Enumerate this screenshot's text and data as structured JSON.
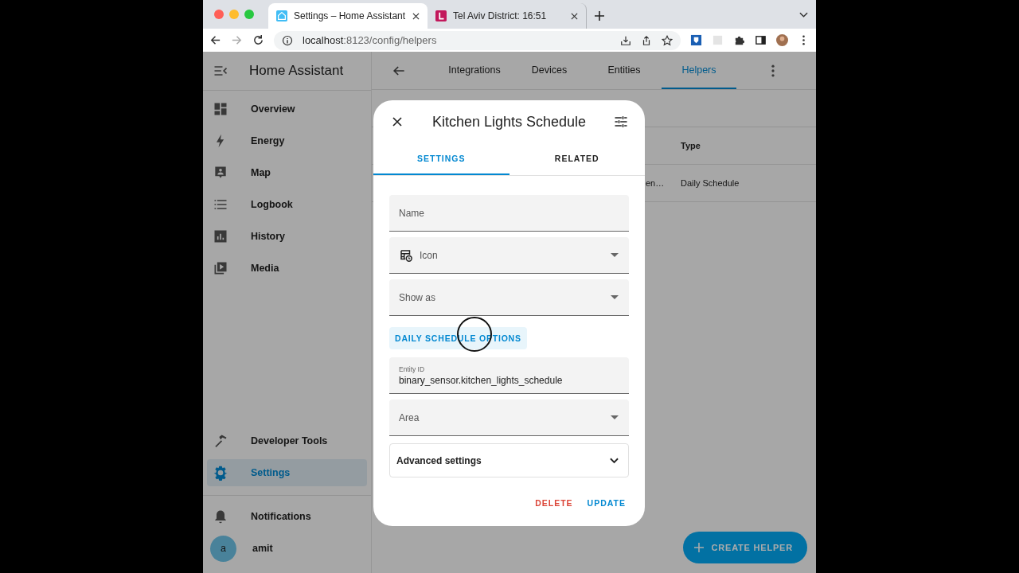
{
  "browser": {
    "tabs": [
      {
        "title": "Settings – Home Assistant",
        "selected": true,
        "kind": "ha"
      },
      {
        "title": "Tel Aviv District: 16:51",
        "selected": false,
        "kind": "red"
      }
    ],
    "url_host": "localhost",
    "url_path": ":8123/config/helpers"
  },
  "sidebar": {
    "title": "Home Assistant",
    "items": [
      {
        "label": "Overview",
        "selected": false
      },
      {
        "label": "Energy",
        "selected": false
      },
      {
        "label": "Map",
        "selected": false
      },
      {
        "label": "Logbook",
        "selected": false
      },
      {
        "label": "History",
        "selected": false
      },
      {
        "label": "Media",
        "selected": false
      }
    ],
    "bottom_items": [
      {
        "label": "Developer Tools",
        "selected": false
      },
      {
        "label": "Settings",
        "selected": true
      }
    ],
    "notifications": "Notifications",
    "user": {
      "initial": "a",
      "name": "amit"
    }
  },
  "main": {
    "tabs": [
      {
        "label": "Integrations",
        "selected": false
      },
      {
        "label": "Devices",
        "selected": false
      },
      {
        "label": "Entities",
        "selected": false
      },
      {
        "label": "Helpers",
        "selected": true
      }
    ],
    "table": {
      "columns": [
        "Type"
      ],
      "rows": [
        {
          "column_1": "en…",
          "type": "Daily Schedule"
        }
      ]
    },
    "fab": "CREATE HELPER"
  },
  "dialog": {
    "title": "Kitchen Lights Schedule",
    "tabs": [
      {
        "label": "SETTINGS",
        "selected": true
      },
      {
        "label": "RELATED",
        "selected": false
      }
    ],
    "fields": [
      {
        "kind": "text",
        "label": "Name"
      },
      {
        "kind": "icon_select",
        "label": "Icon"
      },
      {
        "kind": "select",
        "label": "Show as"
      },
      {
        "kind": "section",
        "label": "DAILY SCHEDULE OPTIONS"
      },
      {
        "kind": "filled",
        "label": "Entity ID",
        "value": "binary_sensor.kitchen_lights_schedule"
      },
      {
        "kind": "select",
        "label": "Area"
      },
      {
        "kind": "expander",
        "label": "Advanced settings",
        "expanded": false
      }
    ],
    "actions": [
      {
        "label": "DELETE",
        "kind": "danger"
      },
      {
        "label": "UPDATE",
        "kind": "primary"
      }
    ]
  }
}
